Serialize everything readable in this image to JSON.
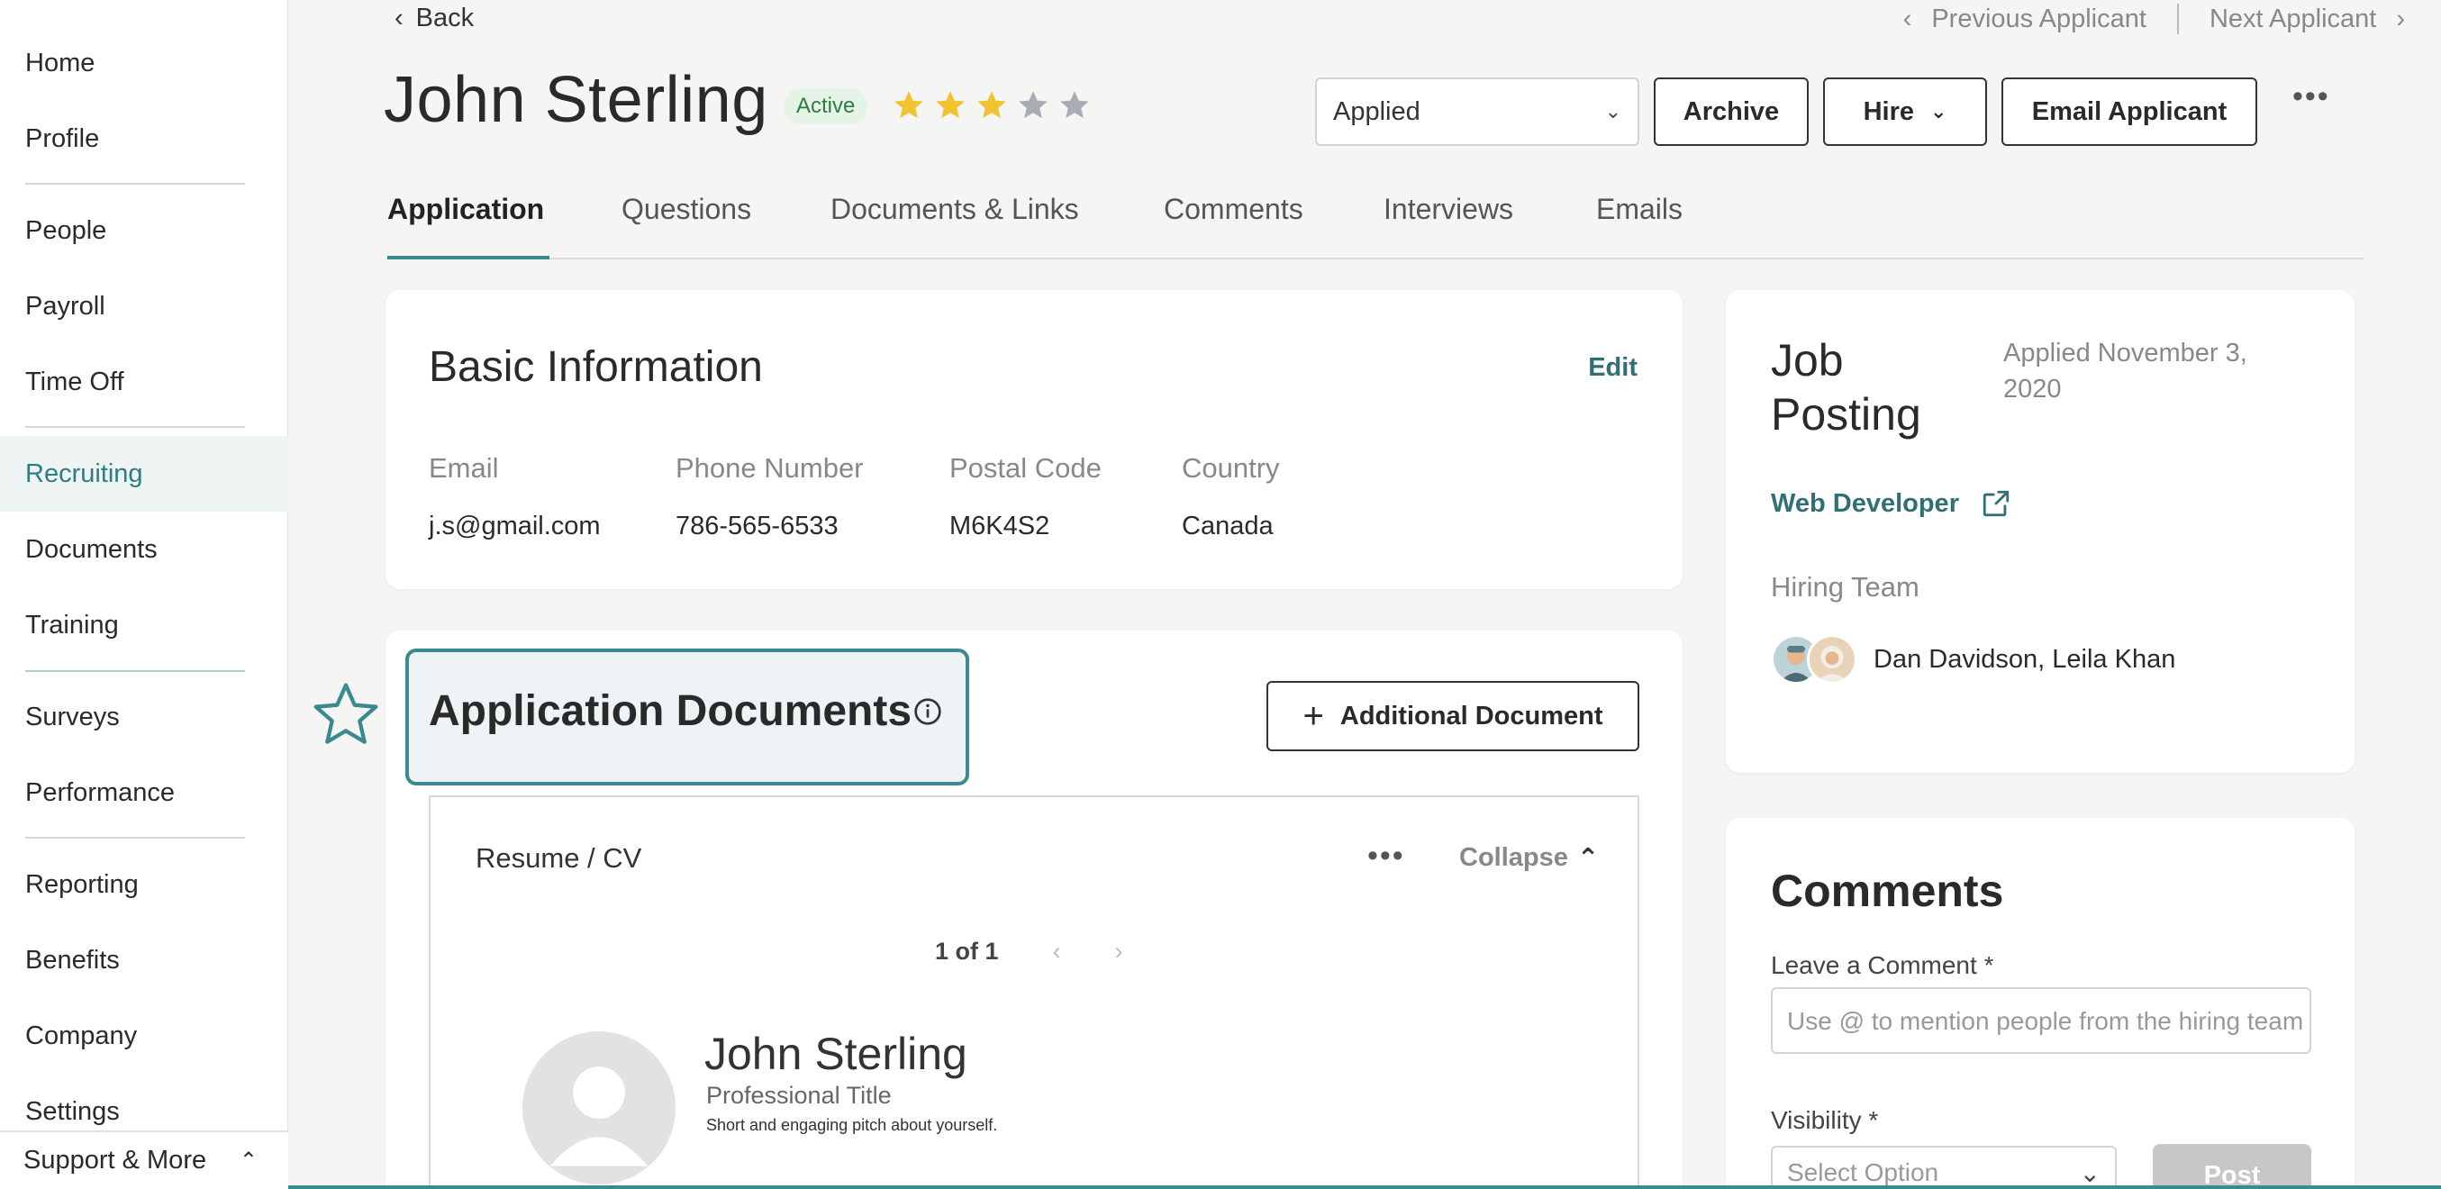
{
  "sidebar": {
    "items": [
      {
        "label": "Home"
      },
      {
        "label": "Profile"
      },
      {
        "label": "People"
      },
      {
        "label": "Payroll"
      },
      {
        "label": "Time Off"
      },
      {
        "label": "Recruiting"
      },
      {
        "label": "Documents"
      },
      {
        "label": "Training"
      },
      {
        "label": "Surveys"
      },
      {
        "label": "Performance"
      },
      {
        "label": "Reporting"
      },
      {
        "label": "Benefits"
      },
      {
        "label": "Company"
      },
      {
        "label": "Settings"
      }
    ],
    "active": "Recruiting",
    "support_label": "Support & More"
  },
  "header": {
    "back_label": "Back",
    "previous_label": "Previous Applicant",
    "next_label": "Next Applicant",
    "applicant_name": "John Sterling",
    "status_badge": "Active",
    "rating": 3,
    "rating_max": 5,
    "stage_select": "Applied",
    "archive_label": "Archive",
    "hire_label": "Hire",
    "email_label": "Email Applicant"
  },
  "tabs": [
    {
      "label": "Application"
    },
    {
      "label": "Questions"
    },
    {
      "label": "Documents & Links"
    },
    {
      "label": "Comments"
    },
    {
      "label": "Interviews"
    },
    {
      "label": "Emails"
    }
  ],
  "basic_info": {
    "title": "Basic Information",
    "edit_label": "Edit",
    "fields": [
      {
        "label": "Email",
        "value": "j.s@gmail.com"
      },
      {
        "label": "Phone Number",
        "value": "786-565-6533"
      },
      {
        "label": "Postal Code",
        "value": "M6K4S2"
      },
      {
        "label": "Country",
        "value": "Canada"
      }
    ]
  },
  "app_docs": {
    "title": "Application Documents",
    "add_label": "Additional Document",
    "resume_label": "Resume / CV",
    "collapse_label": "Collapse",
    "pager": "1 of 1",
    "preview": {
      "name": "John Sterling",
      "title": "Professional Title",
      "pitch": "Short and engaging pitch about yourself."
    }
  },
  "job_posting": {
    "title_line1": "Job",
    "title_line2": "Posting",
    "applied_date": "Applied November 3, 2020",
    "job_link": "Web Developer",
    "hiring_team_label": "Hiring Team",
    "hiring_team_names": "Dan Davidson, Leila Khan"
  },
  "comments": {
    "title": "Comments",
    "leave_label": "Leave a Comment *",
    "placeholder": "Use @ to mention people from the hiring team",
    "visibility_label": "Visibility *",
    "visibility_placeholder": "Select Option",
    "post_label": "Post"
  },
  "colors": {
    "accent": "#3a8a90",
    "star_filled": "#f2c230",
    "star_empty": "#a8adb5",
    "badge_bg": "#e6f4e8",
    "badge_text": "#2f7d3e"
  }
}
